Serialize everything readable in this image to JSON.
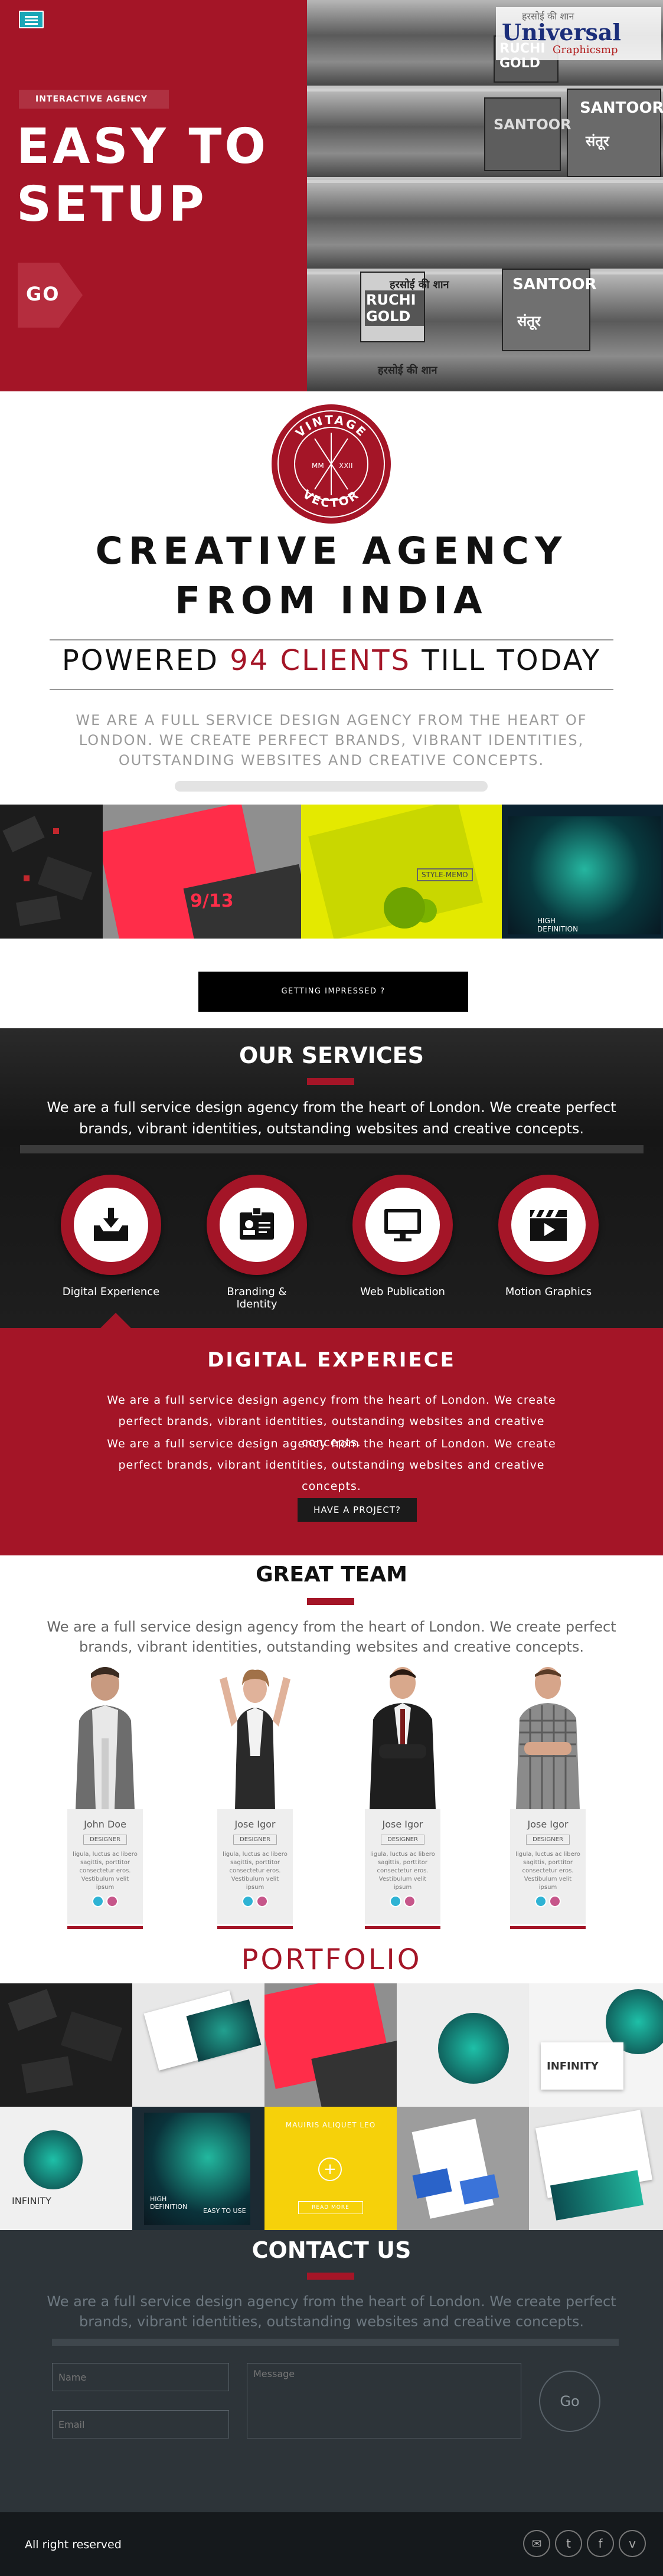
{
  "hero": {
    "tag": "INTERACTIVE AGENCY",
    "title_line1": "EASY TO",
    "title_line2": "SETUP",
    "go_label": "GO",
    "logo_hindi": "हरसोई की शान",
    "logo_main": "Universal",
    "logo_sub": "Graphicsmp",
    "brand1": "RUCHI GOLD",
    "brand2": "SANTOOR",
    "brand2_hindi": "संतूर",
    "shelf_hindi": "हरसोई की शान"
  },
  "badge": {
    "top": "VINTAGE",
    "bottom": "VECTOR",
    "left": "MM",
    "right": "XXII"
  },
  "creative": {
    "heading_line1": "CREATIVE AGENCY",
    "heading_line2": "FROM INDIA",
    "powered_prefix": "POWERED",
    "powered_count": "94 CLIENTS",
    "powered_suffix": "TILL TODAY",
    "paragraph": "WE ARE A FULL SERVICE DESIGN AGENCY FROM THE HEART OF LONDON. WE CREATE PERFECT BRANDS, VIBRANT IDENTITIES, OUTSTANDING WEBSITES AND CREATIVE CONCEPTS."
  },
  "gallery": {
    "tile2_text": "9/13",
    "tile3_text": "STYLE-MEMO",
    "tile4_text": "HIGH DEFINITION"
  },
  "getting_impressed_label": "GETTING IMPRESSED ?",
  "services": {
    "heading": "OUR SERVICES",
    "paragraph": "We are a full service design agency from the heart of London. We create perfect brands, vibrant identities, outstanding websites and creative concepts.",
    "items": [
      {
        "label": "Digital Experience",
        "icon": "inbox-download-icon"
      },
      {
        "label": "Branding & Identity",
        "icon": "id-card-icon"
      },
      {
        "label": "Web Publication",
        "icon": "monitor-icon"
      },
      {
        "label": "Motion Graphics",
        "icon": "clapperboard-icon"
      }
    ]
  },
  "digital": {
    "heading": "DIGITAL EXPERIECE",
    "para1": "We are a full service design agency from the heart of London. We create perfect brands, vibrant identities, outstanding websites and creative concepts.",
    "para2": "We are a full service design agency from the heart of London. We create perfect brands, vibrant identities, outstanding websites and creative concepts.",
    "button": "HAVE A PROJECT?"
  },
  "team": {
    "heading": "GREAT TEAM",
    "paragraph": "We are a full service design agency from the heart of London. We create perfect brands, vibrant identities, outstanding websites and creative concepts.",
    "members": [
      {
        "name": "John Doe",
        "position": "DESIGNER",
        "bio": "ligula, luctus ac libero sagittis, porttitor consectetur eros. Vestibulum velit ipsum"
      },
      {
        "name": "Jose Igor",
        "position": "DESIGNER",
        "bio": "ligula, luctus ac libero sagittis, porttitor consectetur eros. Vestibulum velit ipsum"
      },
      {
        "name": "Jose Igor",
        "position": "DESIGNER",
        "bio": "ligula, luctus ac libero sagittis, porttitor consectetur eros. Vestibulum velit ipsum"
      },
      {
        "name": "Jose Igor",
        "position": "DESIGNER",
        "bio": "ligula, luctus ac libero sagittis, porttitor consectetur eros. Vestibulum velit ipsum"
      }
    ]
  },
  "portfolio": {
    "heading": "PORTFOLIO",
    "overlay_title": "MAUIRIS ALIQUET LEO",
    "overlay_button": "READ MORE",
    "infinity_text": "INFINITY",
    "hd_text": "HIGH DEFINITION",
    "easy_text": "EASY TO USE"
  },
  "contact": {
    "heading": "CONTACT US",
    "paragraph": "We are a full service design agency from the heart of London. We create perfect brands, vibrant identities, outstanding websites and creative concepts.",
    "name_placeholder": "Name",
    "email_placeholder": "Email",
    "message_placeholder": "Message",
    "go_label": "Go"
  },
  "footer": {
    "rights": "All right reserved",
    "icons": [
      "email-icon",
      "twitter-icon",
      "facebook-icon",
      "vimeo-icon"
    ]
  },
  "colors": {
    "brand_red": "#a41527",
    "dark": "#1b1b1b",
    "contact_bg": "#2d3439",
    "menu_teal": "#1aa6b7"
  }
}
